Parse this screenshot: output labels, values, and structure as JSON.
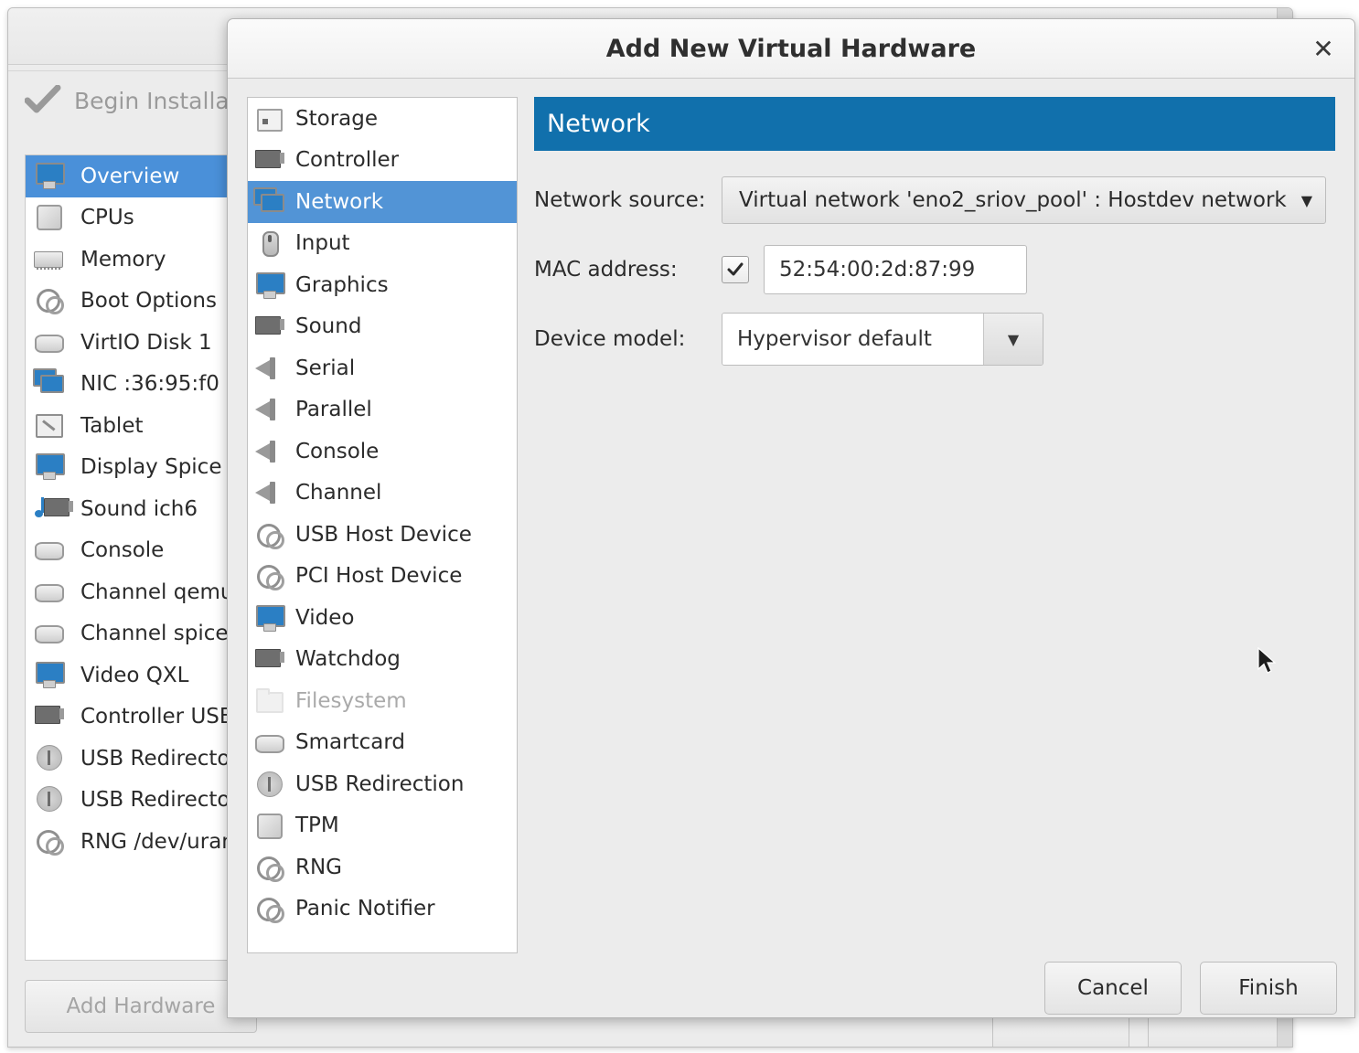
{
  "main_window": {
    "begin_installation_label": "Begin Installati",
    "add_hardware_label": "Add Hardware",
    "hardware_items": [
      {
        "label": "Overview",
        "icon": "computer-icon",
        "selected": true
      },
      {
        "label": "CPUs",
        "icon": "cpu-chip-icon",
        "selected": false
      },
      {
        "label": "Memory",
        "icon": "memory-stick-icon",
        "selected": false
      },
      {
        "label": "Boot Options",
        "icon": "gears-icon",
        "selected": false
      },
      {
        "label": "VirtIO Disk 1",
        "icon": "hard-disk-icon",
        "selected": false
      },
      {
        "label": "NIC :36:95:f0",
        "icon": "network-icon",
        "selected": false
      },
      {
        "label": "Tablet",
        "icon": "tablet-pen-icon",
        "selected": false
      },
      {
        "label": "Display Spice",
        "icon": "display-icon",
        "selected": false
      },
      {
        "label": "Sound ich6",
        "icon": "sound-note-icon",
        "selected": false
      },
      {
        "label": "Console",
        "icon": "serial-port-icon",
        "selected": false
      },
      {
        "label": "Channel qemu-",
        "icon": "serial-port-icon",
        "selected": false
      },
      {
        "label": "Channel spice",
        "icon": "serial-port-icon",
        "selected": false
      },
      {
        "label": "Video QXL",
        "icon": "display-icon",
        "selected": false
      },
      {
        "label": "Controller USB",
        "icon": "controller-card-icon",
        "selected": false
      },
      {
        "label": "USB Redirecto",
        "icon": "usb-icon",
        "selected": false
      },
      {
        "label": "USB Redirecto",
        "icon": "usb-icon",
        "selected": false
      },
      {
        "label": "RNG /dev/uran",
        "icon": "gears-icon",
        "selected": false
      }
    ]
  },
  "dialog": {
    "title": "Add New Virtual Hardware",
    "close_icon": "close-icon",
    "device_list": [
      {
        "label": "Storage",
        "icon": "storage-box-icon",
        "selected": false,
        "disabled": false
      },
      {
        "label": "Controller",
        "icon": "controller-card-icon",
        "selected": false,
        "disabled": false
      },
      {
        "label": "Network",
        "icon": "network-icon",
        "selected": true,
        "disabled": false
      },
      {
        "label": "Input",
        "icon": "mouse-icon",
        "selected": false,
        "disabled": false
      },
      {
        "label": "Graphics",
        "icon": "display-icon",
        "selected": false,
        "disabled": false
      },
      {
        "label": "Sound",
        "icon": "sound-card-icon",
        "selected": false,
        "disabled": false
      },
      {
        "label": "Serial",
        "icon": "serial-plug-icon",
        "selected": false,
        "disabled": false
      },
      {
        "label": "Parallel",
        "icon": "serial-plug-icon",
        "selected": false,
        "disabled": false
      },
      {
        "label": "Console",
        "icon": "serial-plug-icon",
        "selected": false,
        "disabled": false
      },
      {
        "label": "Channel",
        "icon": "serial-plug-icon",
        "selected": false,
        "disabled": false
      },
      {
        "label": "USB Host Device",
        "icon": "gears-icon",
        "selected": false,
        "disabled": false
      },
      {
        "label": "PCI Host Device",
        "icon": "gears-icon",
        "selected": false,
        "disabled": false
      },
      {
        "label": "Video",
        "icon": "display-icon",
        "selected": false,
        "disabled": false
      },
      {
        "label": "Watchdog",
        "icon": "controller-card-icon",
        "selected": false,
        "disabled": false
      },
      {
        "label": "Filesystem",
        "icon": "folder-icon",
        "selected": false,
        "disabled": true
      },
      {
        "label": "Smartcard",
        "icon": "smartcard-icon",
        "selected": false,
        "disabled": false
      },
      {
        "label": "USB Redirection",
        "icon": "usb-icon",
        "selected": false,
        "disabled": false
      },
      {
        "label": "TPM",
        "icon": "cpu-chip-icon",
        "selected": false,
        "disabled": false
      },
      {
        "label": "RNG",
        "icon": "gears-icon",
        "selected": false,
        "disabled": false
      },
      {
        "label": "Panic Notifier",
        "icon": "gears-icon",
        "selected": false,
        "disabled": false
      }
    ],
    "pane": {
      "header": "Network",
      "fields": {
        "network_source_label": "Network source:",
        "network_source_value": "Virtual network 'eno2_sriov_pool' : Hostdev network",
        "mac_address_label": "MAC address:",
        "mac_address_checked": true,
        "mac_address_value": "52:54:00:2d:87:99",
        "device_model_label": "Device model:",
        "device_model_value": "Hypervisor default"
      }
    },
    "buttons": {
      "cancel": "Cancel",
      "finish": "Finish"
    }
  },
  "colors": {
    "pane_header_blue": "#1170ac",
    "dialog_selection_blue": "#5294d6",
    "main_selection_blue": "#4a90d9",
    "window_bg": "#ececec",
    "list_bg": "#ffffff",
    "edge_marker_blue": "#1a72ab"
  }
}
